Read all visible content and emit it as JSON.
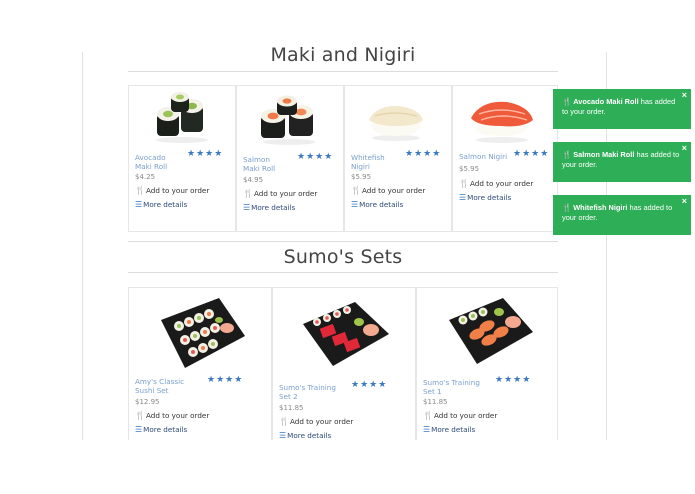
{
  "sections": {
    "maki": {
      "title": "Maki and Nigiri"
    },
    "sets": {
      "title": "Sumo's Sets"
    }
  },
  "maki_items": [
    {
      "name": "Avocado Maki Roll",
      "price": "$4.25",
      "rating": "★★★★",
      "add": "Add to your order",
      "details": "More details"
    },
    {
      "name": "Salmon Maki Roll",
      "price": "$4.95",
      "rating": "★★★★",
      "add": "Add to your order",
      "details": "More details"
    },
    {
      "name": "Whitefish Nigiri",
      "price": "$5.95",
      "rating": "★★★★",
      "add": "Add to your order",
      "details": "More details"
    },
    {
      "name": "Salmon Nigiri",
      "price": "$5.95",
      "rating": "★★★★",
      "add": "Add to your order",
      "details": "More details"
    }
  ],
  "set_items": [
    {
      "name": "Amy's Classic Sushi Set",
      "price": "$12.95",
      "rating": "★★★★",
      "add": "Add to your order",
      "details": "More details"
    },
    {
      "name": "Sumo's Training Set 2",
      "price": "$11.85",
      "rating": "★★★★",
      "add": "Add to your order",
      "details": "More details"
    },
    {
      "name": "Sumo's Training Set 1",
      "price": "$11.85",
      "rating": "★★★★",
      "add": "Add to your order",
      "details": "More details"
    }
  ],
  "toasts": [
    {
      "item": "Avocado Maki Roll",
      "text": "has added to your order.",
      "close": "×"
    },
    {
      "item": "Salmon Maki Roll",
      "text": "has added to your order.",
      "close": "×"
    },
    {
      "item": "Whitefish Nigiri",
      "text": "has added to your order.",
      "close": "×"
    }
  ],
  "icons": {
    "cutlery": "cutlery-icon",
    "list": "list-icon",
    "star": "star-icon",
    "close": "close-icon"
  },
  "colors": {
    "toast_green": "#2eae57",
    "link_blue": "#3a78c2",
    "name_blue": "#7a9fce"
  }
}
